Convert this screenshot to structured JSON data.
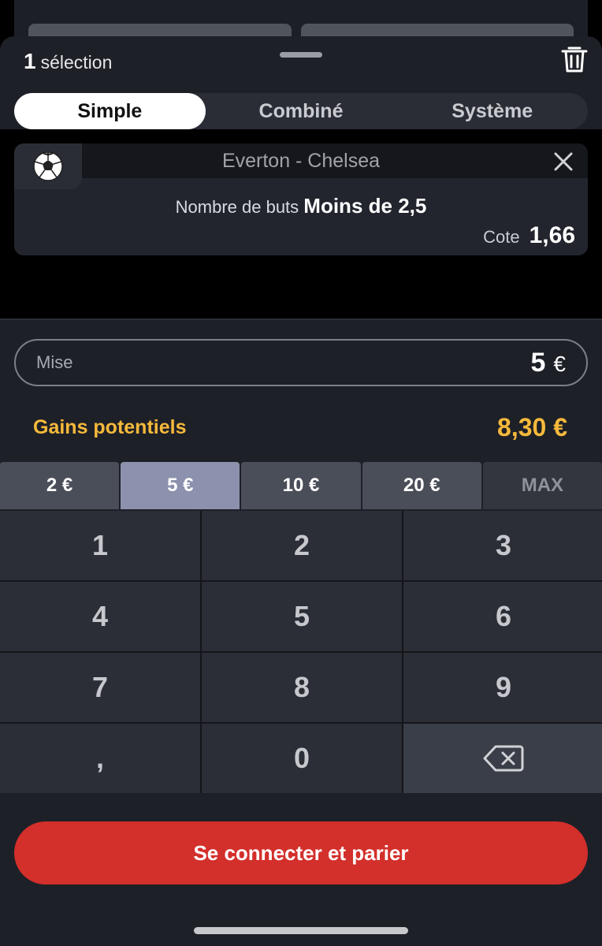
{
  "header": {
    "selection_count": "1",
    "selection_label": "sélection"
  },
  "tabs": [
    {
      "label": "Simple",
      "active": true
    },
    {
      "label": "Combiné",
      "active": false
    },
    {
      "label": "Système",
      "active": false
    }
  ],
  "pick": {
    "sport_icon": "soccer-ball-icon",
    "match": "Everton - Chelsea",
    "market_label": "Nombre de buts",
    "selection": "Moins de 2,5",
    "odds_label": "Cote",
    "odds_value": "1,66"
  },
  "stake": {
    "label": "Mise",
    "value": "5",
    "currency": "€"
  },
  "gains": {
    "label": "Gains potentiels",
    "value": "8,30 €"
  },
  "quick_amounts": [
    {
      "label": "2 €",
      "selected": false
    },
    {
      "label": "5 €",
      "selected": true
    },
    {
      "label": "10 €",
      "selected": false
    },
    {
      "label": "20 €",
      "selected": false
    },
    {
      "label": "MAX",
      "selected": false
    }
  ],
  "keypad": [
    "1",
    "2",
    "3",
    "4",
    "5",
    "6",
    "7",
    "8",
    "9",
    ",",
    "0"
  ],
  "cta_label": "Se connecter et parier",
  "colors": {
    "accent_red": "#d32f2b",
    "gains_yellow": "#f6b93b",
    "selected_quick": "#8c92ad"
  }
}
